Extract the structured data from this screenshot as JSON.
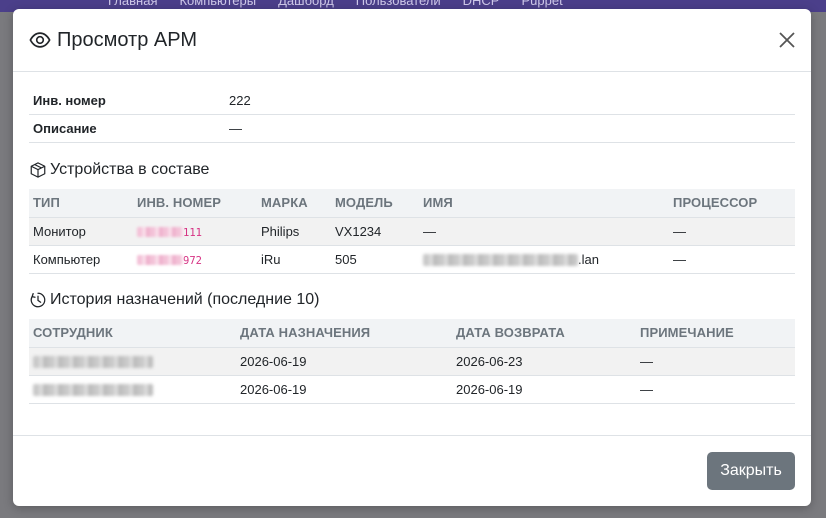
{
  "background_nav": {
    "items": [
      "Главная",
      "Компьютеры",
      "Дашборд",
      "Пользователи",
      "DHCP",
      "Puppet"
    ]
  },
  "modal": {
    "title": "Просмотр АРМ",
    "close_icon": "close-icon",
    "title_icon": "eye-icon",
    "fields": [
      {
        "label": "Инв. номер",
        "value": "222"
      },
      {
        "label": "Описание",
        "value": "—"
      }
    ],
    "devices": {
      "title": "Устройства в составе",
      "icon": "box-icon",
      "columns": [
        "ТИП",
        "ИНВ. НОМЕР",
        "МАРКА",
        "МОДЕЛЬ",
        "ИМЯ",
        "ПРОЦЕССОР"
      ],
      "rows": [
        {
          "type": "Монитор",
          "inv_suffix": "111",
          "brand": "Philips",
          "model": "VX1234",
          "name": "—",
          "name_suffix": "",
          "cpu": "—"
        },
        {
          "type": "Компьютер",
          "inv_suffix": "972",
          "brand": "iRu",
          "model": "505",
          "name": "",
          "name_suffix": ".lan",
          "cpu": "—"
        }
      ]
    },
    "history": {
      "title": "История назначений (последние 10)",
      "icon": "clock-icon",
      "columns": [
        "СОТРУДНИК",
        "ДАТА НАЗНАЧЕНИЯ",
        "ДАТА ВОЗВРАТА",
        "ПРИМЕЧАНИЕ"
      ],
      "rows": [
        {
          "assigned": "2026-06-19",
          "returned": "2026-06-23",
          "note": "—"
        },
        {
          "assigned": "2026-06-19",
          "returned": "2026-06-19",
          "note": "—"
        }
      ]
    },
    "footer": {
      "close_label": "Закрыть"
    }
  },
  "colors": {
    "navbar": "#4b3f8a",
    "inv_accent": "#d63384",
    "button": "#6c757d"
  }
}
